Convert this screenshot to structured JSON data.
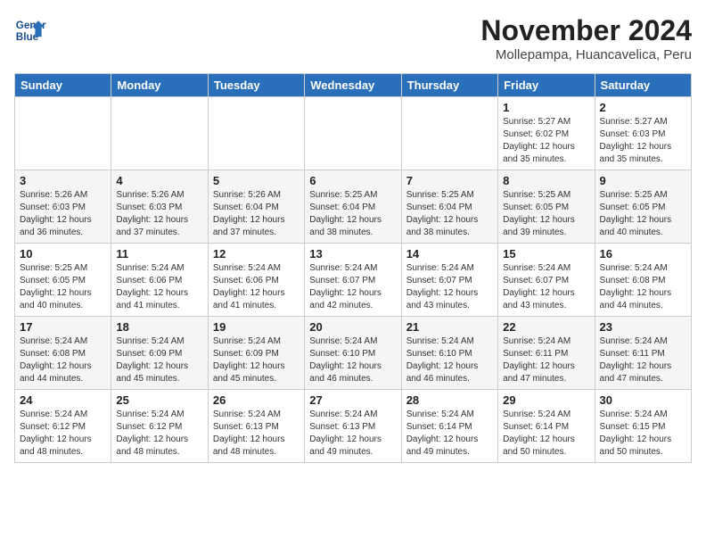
{
  "header": {
    "logo_line1": "General",
    "logo_line2": "Blue",
    "title": "November 2024",
    "subtitle": "Mollepampa, Huancavelica, Peru"
  },
  "weekdays": [
    "Sunday",
    "Monday",
    "Tuesday",
    "Wednesday",
    "Thursday",
    "Friday",
    "Saturday"
  ],
  "weeks": [
    [
      {
        "day": "",
        "detail": ""
      },
      {
        "day": "",
        "detail": ""
      },
      {
        "day": "",
        "detail": ""
      },
      {
        "day": "",
        "detail": ""
      },
      {
        "day": "",
        "detail": ""
      },
      {
        "day": "1",
        "detail": "Sunrise: 5:27 AM\nSunset: 6:02 PM\nDaylight: 12 hours and 35 minutes."
      },
      {
        "day": "2",
        "detail": "Sunrise: 5:27 AM\nSunset: 6:03 PM\nDaylight: 12 hours and 35 minutes."
      }
    ],
    [
      {
        "day": "3",
        "detail": "Sunrise: 5:26 AM\nSunset: 6:03 PM\nDaylight: 12 hours and 36 minutes."
      },
      {
        "day": "4",
        "detail": "Sunrise: 5:26 AM\nSunset: 6:03 PM\nDaylight: 12 hours and 37 minutes."
      },
      {
        "day": "5",
        "detail": "Sunrise: 5:26 AM\nSunset: 6:04 PM\nDaylight: 12 hours and 37 minutes."
      },
      {
        "day": "6",
        "detail": "Sunrise: 5:25 AM\nSunset: 6:04 PM\nDaylight: 12 hours and 38 minutes."
      },
      {
        "day": "7",
        "detail": "Sunrise: 5:25 AM\nSunset: 6:04 PM\nDaylight: 12 hours and 38 minutes."
      },
      {
        "day": "8",
        "detail": "Sunrise: 5:25 AM\nSunset: 6:05 PM\nDaylight: 12 hours and 39 minutes."
      },
      {
        "day": "9",
        "detail": "Sunrise: 5:25 AM\nSunset: 6:05 PM\nDaylight: 12 hours and 40 minutes."
      }
    ],
    [
      {
        "day": "10",
        "detail": "Sunrise: 5:25 AM\nSunset: 6:05 PM\nDaylight: 12 hours and 40 minutes."
      },
      {
        "day": "11",
        "detail": "Sunrise: 5:24 AM\nSunset: 6:06 PM\nDaylight: 12 hours and 41 minutes."
      },
      {
        "day": "12",
        "detail": "Sunrise: 5:24 AM\nSunset: 6:06 PM\nDaylight: 12 hours and 41 minutes."
      },
      {
        "day": "13",
        "detail": "Sunrise: 5:24 AM\nSunset: 6:07 PM\nDaylight: 12 hours and 42 minutes."
      },
      {
        "day": "14",
        "detail": "Sunrise: 5:24 AM\nSunset: 6:07 PM\nDaylight: 12 hours and 43 minutes."
      },
      {
        "day": "15",
        "detail": "Sunrise: 5:24 AM\nSunset: 6:07 PM\nDaylight: 12 hours and 43 minutes."
      },
      {
        "day": "16",
        "detail": "Sunrise: 5:24 AM\nSunset: 6:08 PM\nDaylight: 12 hours and 44 minutes."
      }
    ],
    [
      {
        "day": "17",
        "detail": "Sunrise: 5:24 AM\nSunset: 6:08 PM\nDaylight: 12 hours and 44 minutes."
      },
      {
        "day": "18",
        "detail": "Sunrise: 5:24 AM\nSunset: 6:09 PM\nDaylight: 12 hours and 45 minutes."
      },
      {
        "day": "19",
        "detail": "Sunrise: 5:24 AM\nSunset: 6:09 PM\nDaylight: 12 hours and 45 minutes."
      },
      {
        "day": "20",
        "detail": "Sunrise: 5:24 AM\nSunset: 6:10 PM\nDaylight: 12 hours and 46 minutes."
      },
      {
        "day": "21",
        "detail": "Sunrise: 5:24 AM\nSunset: 6:10 PM\nDaylight: 12 hours and 46 minutes."
      },
      {
        "day": "22",
        "detail": "Sunrise: 5:24 AM\nSunset: 6:11 PM\nDaylight: 12 hours and 47 minutes."
      },
      {
        "day": "23",
        "detail": "Sunrise: 5:24 AM\nSunset: 6:11 PM\nDaylight: 12 hours and 47 minutes."
      }
    ],
    [
      {
        "day": "24",
        "detail": "Sunrise: 5:24 AM\nSunset: 6:12 PM\nDaylight: 12 hours and 48 minutes."
      },
      {
        "day": "25",
        "detail": "Sunrise: 5:24 AM\nSunset: 6:12 PM\nDaylight: 12 hours and 48 minutes."
      },
      {
        "day": "26",
        "detail": "Sunrise: 5:24 AM\nSunset: 6:13 PM\nDaylight: 12 hours and 48 minutes."
      },
      {
        "day": "27",
        "detail": "Sunrise: 5:24 AM\nSunset: 6:13 PM\nDaylight: 12 hours and 49 minutes."
      },
      {
        "day": "28",
        "detail": "Sunrise: 5:24 AM\nSunset: 6:14 PM\nDaylight: 12 hours and 49 minutes."
      },
      {
        "day": "29",
        "detail": "Sunrise: 5:24 AM\nSunset: 6:14 PM\nDaylight: 12 hours and 50 minutes."
      },
      {
        "day": "30",
        "detail": "Sunrise: 5:24 AM\nSunset: 6:15 PM\nDaylight: 12 hours and 50 minutes."
      }
    ]
  ]
}
